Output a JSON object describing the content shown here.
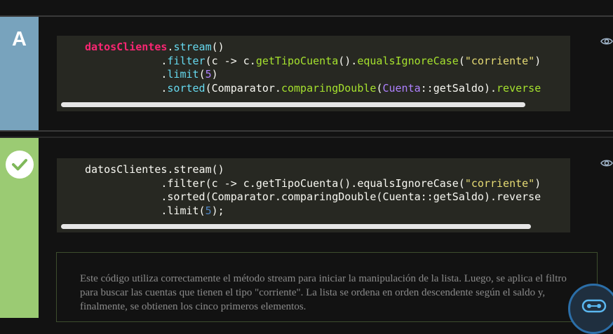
{
  "option_a": {
    "letter": "A",
    "code_lines": [
      [
        {
          "t": "datosClientes",
          "c": "v"
        },
        {
          "t": ".",
          "c": ""
        },
        {
          "t": "stream",
          "c": "m"
        },
        {
          "t": "()",
          "c": ""
        }
      ],
      [
        {
          "t": "            .",
          "c": ""
        },
        {
          "t": "filter",
          "c": "m"
        },
        {
          "t": "(c -> c.",
          "c": ""
        },
        {
          "t": "getTipoCuenta",
          "c": "f"
        },
        {
          "t": "().",
          "c": ""
        },
        {
          "t": "equalsIgnoreCase",
          "c": "f"
        },
        {
          "t": "(",
          "c": ""
        },
        {
          "t": "\"corriente\"",
          "c": "s"
        },
        {
          "t": ")",
          "c": ""
        }
      ],
      [
        {
          "t": "            .",
          "c": ""
        },
        {
          "t": "limit",
          "c": "m"
        },
        {
          "t": "(",
          "c": ""
        },
        {
          "t": "5",
          "c": "n"
        },
        {
          "t": ")",
          "c": ""
        }
      ],
      [
        {
          "t": "            .",
          "c": ""
        },
        {
          "t": "sorted",
          "c": "m"
        },
        {
          "t": "(Comparator.",
          "c": ""
        },
        {
          "t": "comparingDouble",
          "c": "f"
        },
        {
          "t": "(",
          "c": ""
        },
        {
          "t": "Cuenta",
          "c": "n"
        },
        {
          "t": "::getSaldo).",
          "c": ""
        },
        {
          "t": "reverse",
          "c": "f"
        }
      ]
    ]
  },
  "option_b": {
    "status": "correct",
    "code_lines": [
      [
        {
          "t": "datosClientes.stream()",
          "c": ""
        }
      ],
      [
        {
          "t": "            .filter(c -> c.getTipoCuenta().equalsIgnoreCase(",
          "c": ""
        },
        {
          "t": "\"corriente\"",
          "c": "s"
        },
        {
          "t": ")",
          "c": ""
        }
      ],
      [
        {
          "t": "            .sorted(Comparator.comparingDouble(Cuenta::getSaldo).reverse",
          "c": ""
        }
      ],
      [
        {
          "t": "            .limit(",
          "c": ""
        },
        {
          "t": "5",
          "c": "b"
        },
        {
          "t": ");",
          "c": ""
        }
      ]
    ],
    "explanation": "Este código utiliza correctamente el método stream para iniciar la manipulación de la lista. Luego, se aplica el filtro para buscar las cuentas que tienen el tipo \"corriente\". La lista se ordena en orden descendente según el saldo y, finalmente, se obtienen los cinco primeros elementos."
  },
  "icons": {
    "eye": "eye-icon",
    "check": "checkmark-icon",
    "assistant": "robot-assistant-icon"
  },
  "colors": {
    "option_a_strip": "#78a3bd",
    "option_b_strip": "#9bcb73",
    "code_bg": "#272822"
  }
}
